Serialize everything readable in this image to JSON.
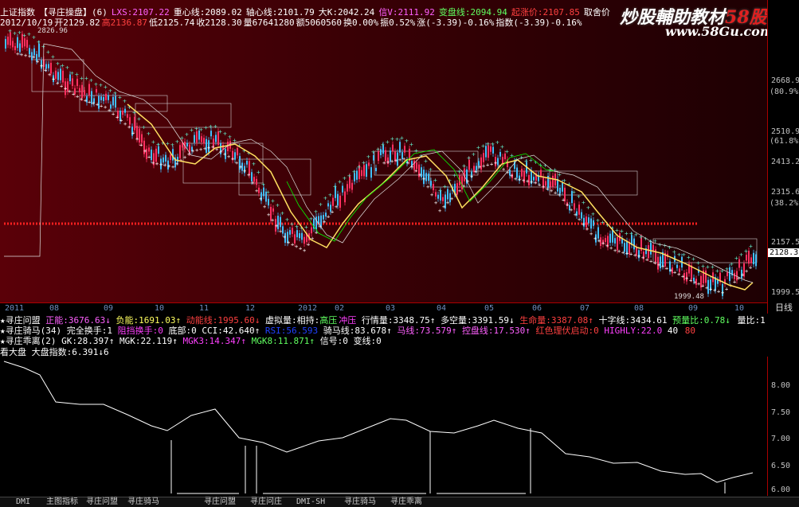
{
  "header": {
    "index_name": "上证指数",
    "indicator_tab": "【寻庄操盘】",
    "indicator_num": "(6)",
    "lxs": "LXS:2107.22",
    "zhongxin": "重心线:2089.02",
    "zhouxin": "轴心线:2101.79",
    "dak": "大K:2042.24",
    "xin": "信V:2111.92",
    "bianpan": "变盘线:2094.94",
    "qizhang": "起涨价:2107.85",
    "qushe": "取舍价",
    "date": "2012/10/19",
    "open": "开2129.82",
    "high": "高2136.87",
    "low": "低2125.74",
    "close": "收2128.30",
    "volume": "量67641280",
    "amount": "额5060560",
    "turnover": "换0.00%",
    "amplitude": "振0.52%",
    "change": "涨(-3.39)-0.16%",
    "index_change": "指数(-3.39)-0.16%",
    "top_left_tick": "2826.96"
  },
  "watermark": {
    "text_cn": "炒股輔助教材",
    "text_red": "58股网",
    "url": "www.58Gu.com"
  },
  "price_axis": [
    {
      "label": "2668.9",
      "pct": "(80.9%)"
    },
    {
      "label": "2510.9",
      "pct": "(61.8%)"
    },
    {
      "label": "2413.2",
      "pct": ""
    },
    {
      "label": "2315.6",
      "pct": "(38.2%)"
    },
    {
      "label": "2157.5",
      "pct": ""
    },
    {
      "label": "2128.3",
      "pct": ""
    },
    {
      "label": "1999.5",
      "pct": ""
    }
  ],
  "low_marker": "1999.48",
  "date_axis": [
    "2011",
    "08",
    "09",
    "10",
    "11",
    "12",
    "2012",
    "02",
    "03",
    "04",
    "05",
    "06",
    "07",
    "08",
    "09",
    "10"
  ],
  "period": "日线",
  "indicators": {
    "row1": {
      "name": "★寻庄问盟",
      "zhengneng": "正能:3676.63↓",
      "funeng": "负能:1691.03↑",
      "dongneng": "动能线:1995.60↓",
      "xuni": "虚拟量:",
      "xiangchi": "相持:",
      "gaoya": "高压",
      "chongya": "冲压",
      "xingqing": "行情量:3348.75↑",
      "duokong": "多空量:3391.59↓",
      "shengming": "生命量:3387.08↑",
      "shizi": "十字线:3434.61",
      "yuliang": "预量比:0.78↓",
      "liangbi": "量比:1."
    },
    "row2": {
      "name": "★寻庄骑马",
      "num": "(34)",
      "wanquan": "完全换手:1",
      "zuzhuang": "阻挡换手:0",
      "dibu": "底部:0",
      "cci": "CCI:42.640↑",
      "rsi": "RSI:56.593",
      "qima": "骑马线:83.678↑",
      "maxian": "马线:73.579↑",
      "kongpan": "控盘线:17.530↑",
      "hongse": "红色理伏启动:0",
      "highly": "HIGHLY:22.0",
      "n40": "40",
      "n80": "80"
    },
    "row3": {
      "name": "★寻庄乖离",
      "num": "(2)",
      "gk": "GK:28.397↑",
      "mgk": "MGK:22.119↑",
      "mgk3": "MGK3:14.347↑",
      "mgk8": "MGK8:11.871↑",
      "xinhao": "信号:0",
      "bianxian": "变线:0"
    },
    "row4": {
      "name": "看大盘",
      "value": "大盘指数:6.391↓6"
    }
  },
  "lower_axis": [
    "8.00",
    "7.50",
    "7.00",
    "6.50",
    "6.00"
  ],
  "tabs": [
    "DMI",
    "主图指标",
    "寻庄问盟",
    "寻庄骑马",
    "寻庄问盟",
    "寻庄问庄",
    "DMI-SH",
    "寻庄骑马",
    "寻庄乖离"
  ],
  "colors": {
    "up": "#ff3060",
    "down": "#40c0ff",
    "cyan_cross": "#60e0c0",
    "white_cross": "#ffffff",
    "yellow": "#ffe060",
    "green_line": "#00ff00",
    "magenta": "#ff40ff",
    "dotted_red": "#ff2020"
  }
}
